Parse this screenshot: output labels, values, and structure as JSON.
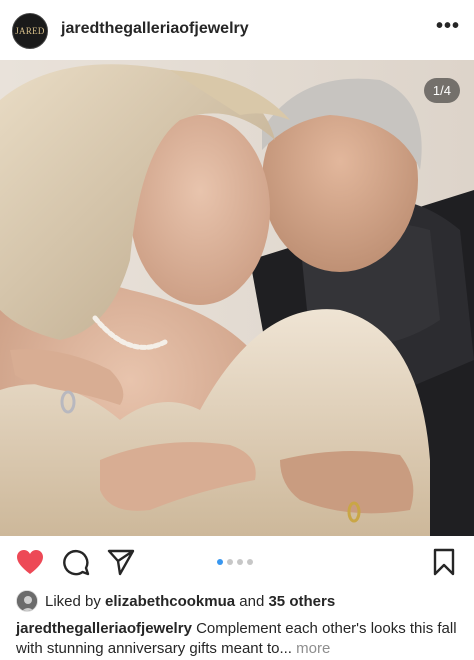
{
  "post": {
    "username": "jaredthegalleriaofjewelry",
    "avatar_text": "JARED",
    "more_icon": "more-horizontal-icon",
    "image_counter": "1/4",
    "carousel": {
      "total": 4,
      "active_index": 0
    }
  },
  "actions": {
    "like_icon": "heart-filled-icon",
    "comment_icon": "comment-icon",
    "share_icon": "send-icon",
    "save_icon": "bookmark-icon",
    "like_color": "#ed4956"
  },
  "likes": {
    "prefix": "Liked by",
    "user": "elizabethcookmua",
    "connector": "and",
    "others": "35 others"
  },
  "caption": {
    "username": "jaredthegalleriaofjewelry",
    "text": "Complement each other's looks this fall with stunning anniversary gifts meant to...",
    "more_label": "more"
  }
}
